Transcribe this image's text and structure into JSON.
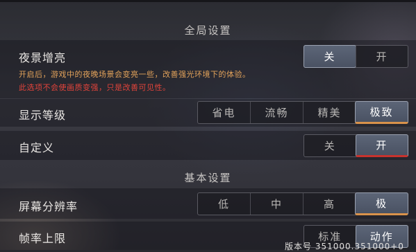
{
  "sections": {
    "global": "全局设置",
    "basic": "基本设置"
  },
  "night_view": {
    "label": "夜景增亮",
    "desc_1": "开启后，游戏中的夜晚场景会变亮一些，改善强光环境下的体验。",
    "desc_2": "此选项不会使画质变强，只是改善可见性。",
    "options": [
      "关",
      "开"
    ],
    "selected": "关"
  },
  "display_level": {
    "label": "显示等级",
    "options": [
      "省电",
      "流畅",
      "精美",
      "极致"
    ],
    "selected": "极致"
  },
  "custom": {
    "label": "自定义",
    "options": [
      "关",
      "开"
    ],
    "selected": "开"
  },
  "resolution": {
    "label": "屏幕分辨率",
    "options": [
      "低",
      "中",
      "高",
      "极"
    ],
    "selected": "极"
  },
  "frame_rate": {
    "label": "帧率上限",
    "options": [
      "标准",
      "动作"
    ],
    "selected": "动作"
  },
  "version": "版本号 351000.351000+0",
  "colors": {
    "accent_orange": "#d9924a",
    "accent_red": "#c8322d",
    "desc_orange": "#e2a25a",
    "desc_red": "#e0433a"
  }
}
